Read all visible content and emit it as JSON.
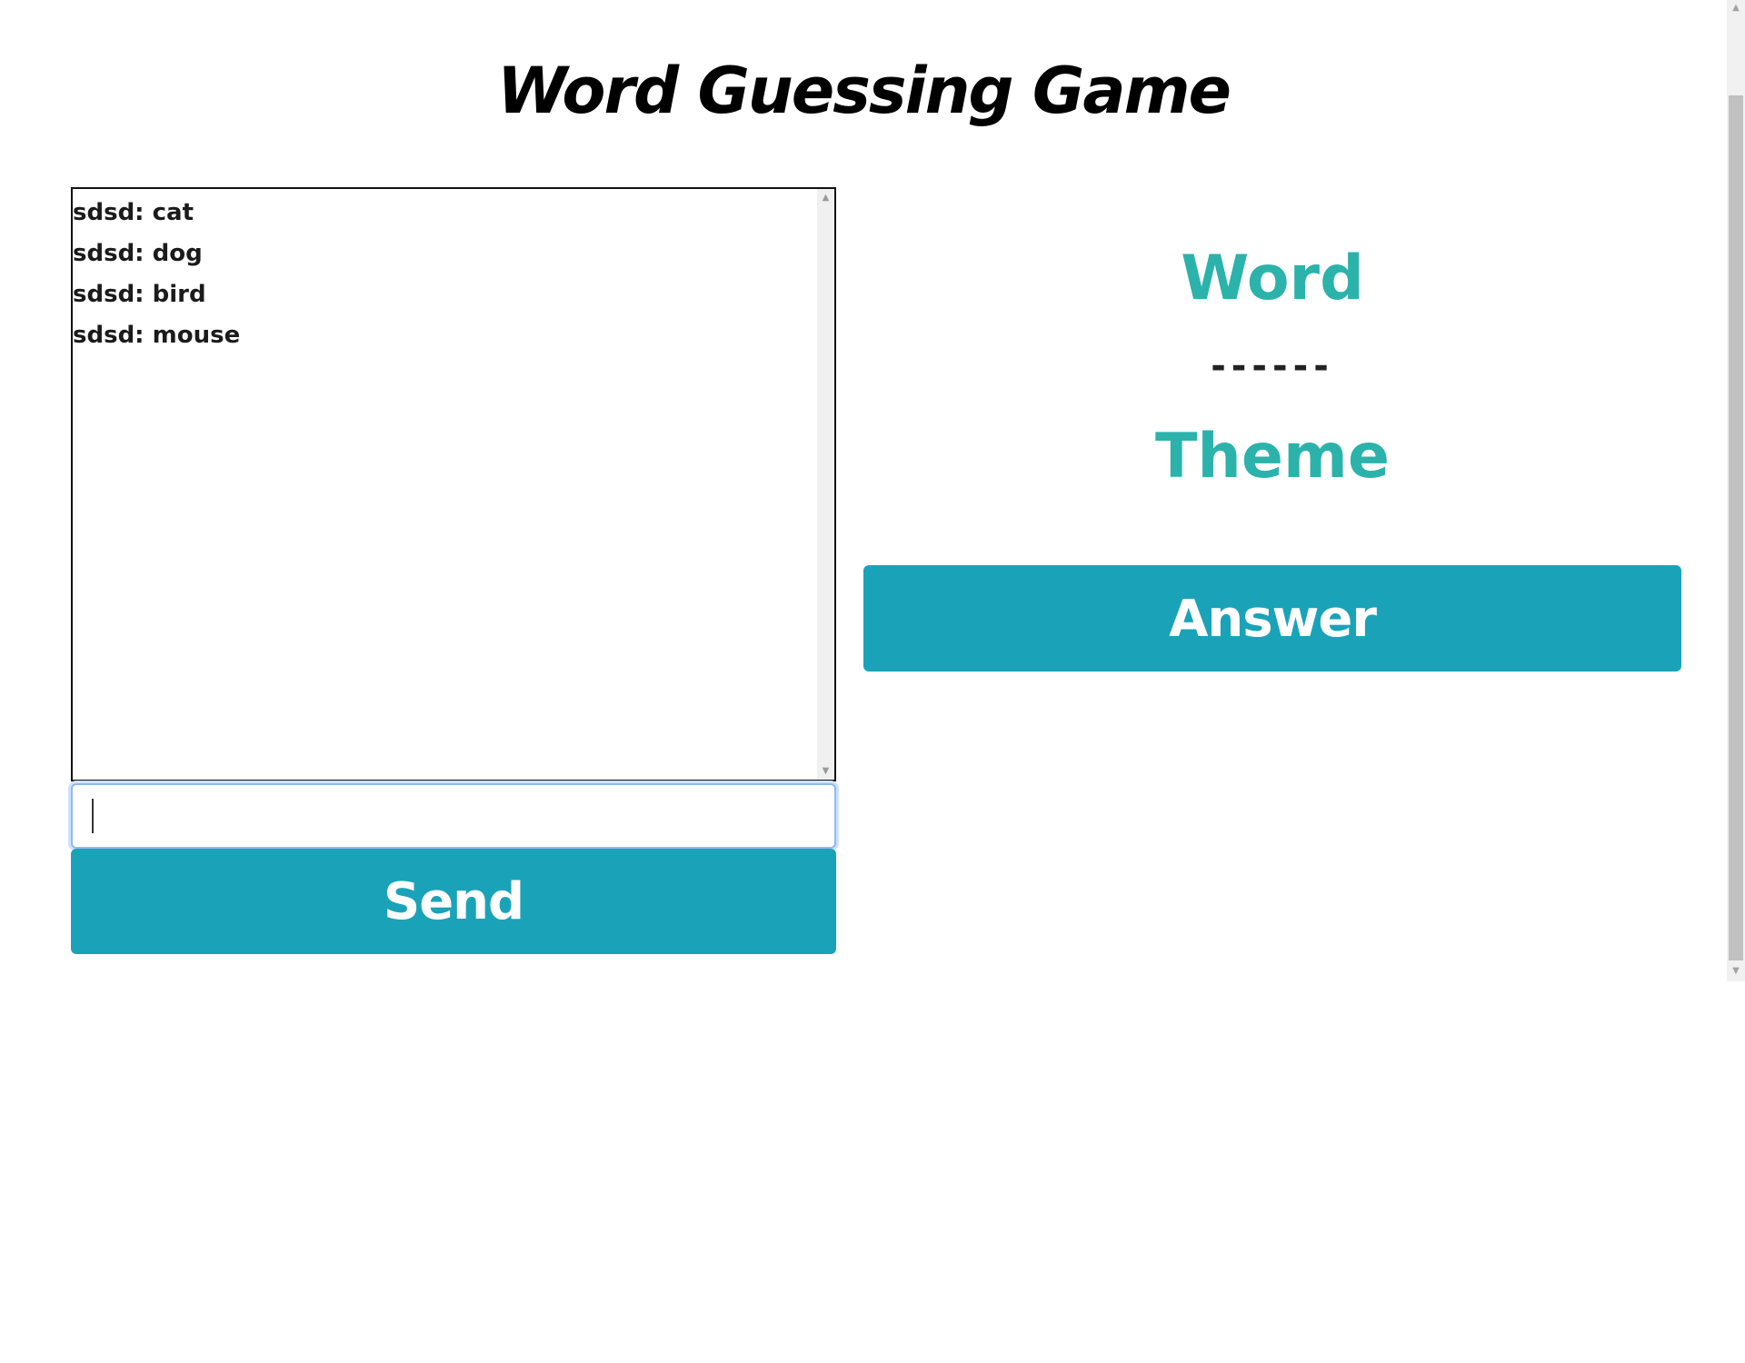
{
  "title": "Word Guessing Game",
  "chat": {
    "messages": [
      {
        "text": "sdsd: cat"
      },
      {
        "text": "sdsd: dog"
      },
      {
        "text": "sdsd: bird"
      },
      {
        "text": "sdsd: mouse"
      }
    ]
  },
  "input": {
    "value": "",
    "placeholder": ""
  },
  "buttons": {
    "send_label": "Send",
    "answer_label": "Answer"
  },
  "word_panel": {
    "word_label": "Word",
    "word_blanks": "------",
    "theme_label": "Theme"
  },
  "colors": {
    "accent": "#1aa3b8",
    "label": "#2bb3ab",
    "text": "#1b1b1b"
  },
  "icons": {
    "scroll_up": "scroll-up-arrow-icon",
    "scroll_down": "scroll-down-arrow-icon"
  }
}
